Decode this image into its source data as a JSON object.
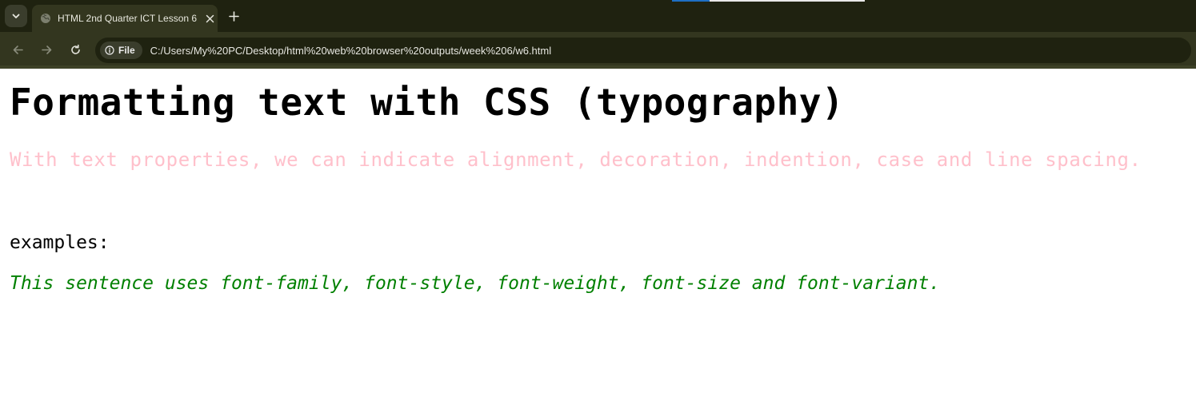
{
  "browser": {
    "tab": {
      "title": "HTML 2nd Quarter ICT Lesson 6",
      "favicon_icon": "globe-icon",
      "close_icon": "close-icon"
    },
    "tab_menu_icon": "chevron-down-icon",
    "new_tab_icon": "plus-icon",
    "nav": {
      "back_icon": "arrow-left-icon",
      "forward_icon": "arrow-right-icon",
      "reload_icon": "reload-icon"
    },
    "address_bar": {
      "site_info_icon": "info-icon",
      "scheme_label": "File",
      "url": "C:/Users/My%20PC/Desktop/html%20web%20browser%20outputs/week%206/w6.html"
    },
    "colors": {
      "tabstrip": "#1f2210",
      "toolbar": "#33361f",
      "omnibox": "#1f2210"
    }
  },
  "page": {
    "heading": "Formatting text with CSS (typography)",
    "intro": "With text properties, we can indicate alignment, decoration, indention, case and line spacing.",
    "examples_label": "examples:",
    "example_sentence": "This sentence uses font-family, font-style, font-weight, font-size and font-variant.",
    "colors": {
      "intro": "#ffc0cb",
      "example_sentence": "#008000"
    }
  }
}
